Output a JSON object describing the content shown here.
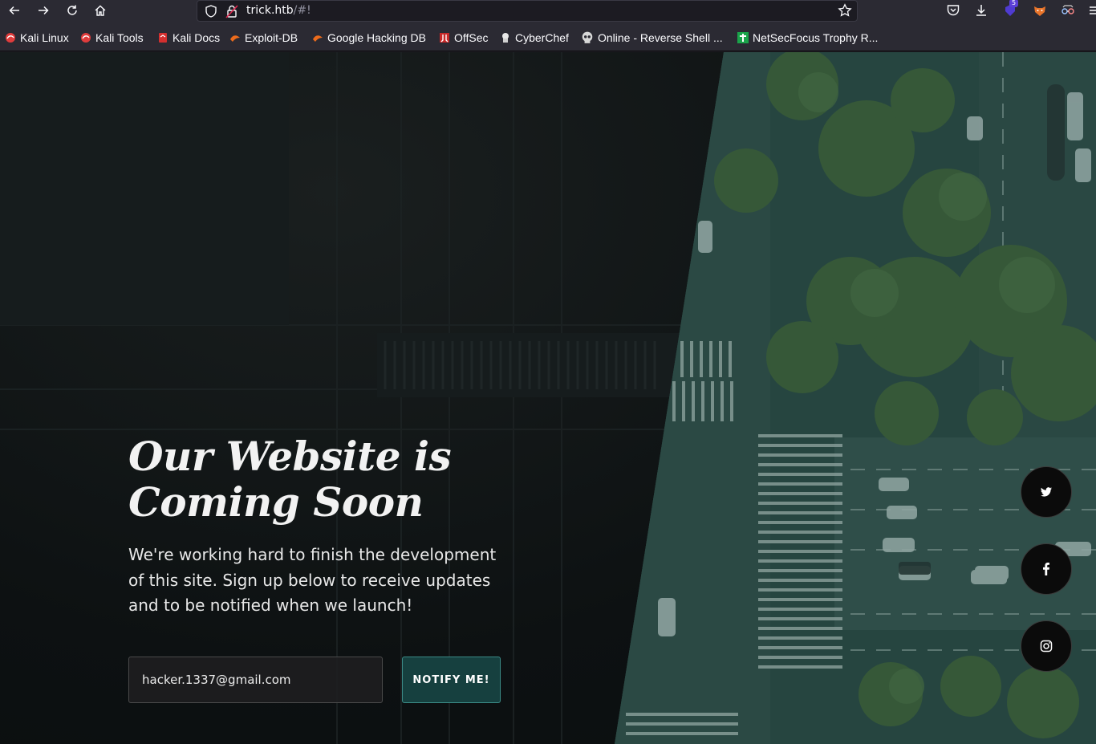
{
  "browser": {
    "url_host": "trick.htb",
    "url_path": "/#!",
    "extension_badge": "5",
    "bookmarks": [
      {
        "label": "Kali Linux",
        "icon": "kali-icon"
      },
      {
        "label": "Kali Tools",
        "icon": "kali-icon"
      },
      {
        "label": "Kali Docs",
        "icon": "kali-docs-icon"
      },
      {
        "label": "Exploit-DB",
        "icon": "exploit-db-icon"
      },
      {
        "label": "Google Hacking DB",
        "icon": "exploit-db-icon"
      },
      {
        "label": "OffSec",
        "icon": "offsec-icon"
      },
      {
        "label": "CyberChef",
        "icon": "cyberchef-icon"
      },
      {
        "label": "Online - Reverse Shell ...",
        "icon": "skull-icon"
      },
      {
        "label": "NetSecFocus Trophy R...",
        "icon": "trophy-icon"
      }
    ]
  },
  "page": {
    "title": "Our Website is Coming Soon",
    "text": "We're working hard to finish the development of this site. Sign up below to receive updates and to be notified when we launch!",
    "email_value": "hacker.1337@gmail.com",
    "notify_label": "NOTIFY ME!",
    "social": [
      "twitter-icon",
      "facebook-icon",
      "instagram-icon"
    ]
  },
  "colors": {
    "chrome": "#2b2a33",
    "accent_button": "#16403f",
    "button_border": "#3b8a86"
  }
}
